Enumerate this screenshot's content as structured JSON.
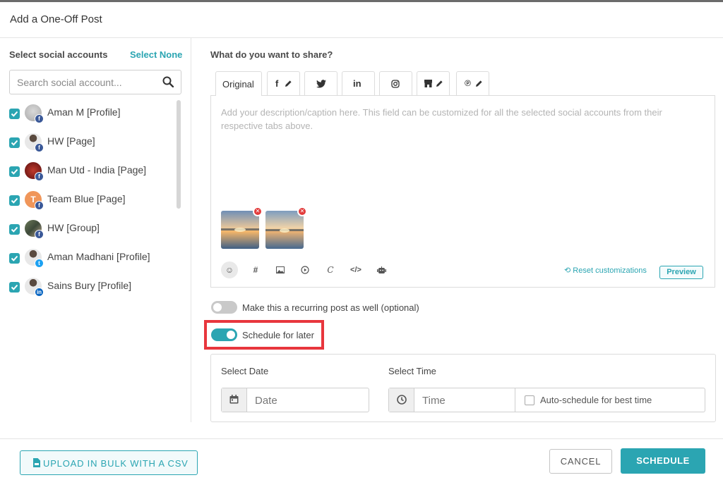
{
  "dialog": {
    "title": "Add a One-Off Post"
  },
  "accounts": {
    "heading": "Select social accounts",
    "select_none": "Select None",
    "search_placeholder": "Search social account...",
    "items": [
      {
        "label": "Aman M [Profile]",
        "network": "facebook",
        "avatar": "photo-gray",
        "checked": true
      },
      {
        "label": "HW [Page]",
        "network": "facebook",
        "avatar": "photo-person",
        "checked": true
      },
      {
        "label": "Man Utd - India [Page]",
        "network": "facebook",
        "avatar": "photo-red",
        "checked": true
      },
      {
        "label": "Team Blue [Page]",
        "network": "facebook",
        "avatar": "letter",
        "avatar_letter": "T",
        "checked": true
      },
      {
        "label": "HW [Group]",
        "network": "facebook",
        "avatar": "photo-group",
        "checked": true
      },
      {
        "label": "Aman Madhani [Profile]",
        "network": "twitter",
        "avatar": "photo-person",
        "checked": true
      },
      {
        "label": "Sains Bury [Profile]",
        "network": "linkedin",
        "avatar": "photo-person",
        "checked": true
      }
    ]
  },
  "composer": {
    "heading": "What do you want to share?",
    "tabs": [
      {
        "label": "Original",
        "icon": null,
        "active": true
      },
      {
        "label": "",
        "icon": "facebook-edit-icon"
      },
      {
        "label": "",
        "icon": "twitter-icon"
      },
      {
        "label": "",
        "icon": "linkedin-icon"
      },
      {
        "label": "",
        "icon": "instagram-icon"
      },
      {
        "label": "",
        "icon": "google-business-edit-icon"
      },
      {
        "label": "",
        "icon": "pinterest-edit-icon"
      }
    ],
    "caption_placeholder": "Add your description/caption here. This field can be customized for all the selected social accounts from their respective tabs above.",
    "toolbar_icons": [
      "emoji-icon",
      "hashtag-icon",
      "image-icon",
      "video-icon",
      "canva-icon",
      "code-icon",
      "bot-icon"
    ],
    "reset_label": "Reset customizations",
    "preview_label": "Preview"
  },
  "options": {
    "recurring_label": "Make this a recurring post as well (optional)",
    "recurring_on": false,
    "schedule_label": "Schedule for later",
    "schedule_on": true
  },
  "schedule": {
    "date_label": "Select Date",
    "date_placeholder": "Date",
    "time_label": "Select Time",
    "time_placeholder": "Time",
    "auto_label": "Auto-schedule for best time"
  },
  "footer": {
    "csv_label": "UPLOAD IN BULK WITH A CSV",
    "cancel_label": "CANCEL",
    "schedule_label": "SCHEDULE"
  },
  "colors": {
    "accent": "#2ba5b2",
    "highlight": "#e8363d",
    "facebook": "#3b5998",
    "twitter": "#1da1f2",
    "linkedin": "#0a66c2"
  }
}
